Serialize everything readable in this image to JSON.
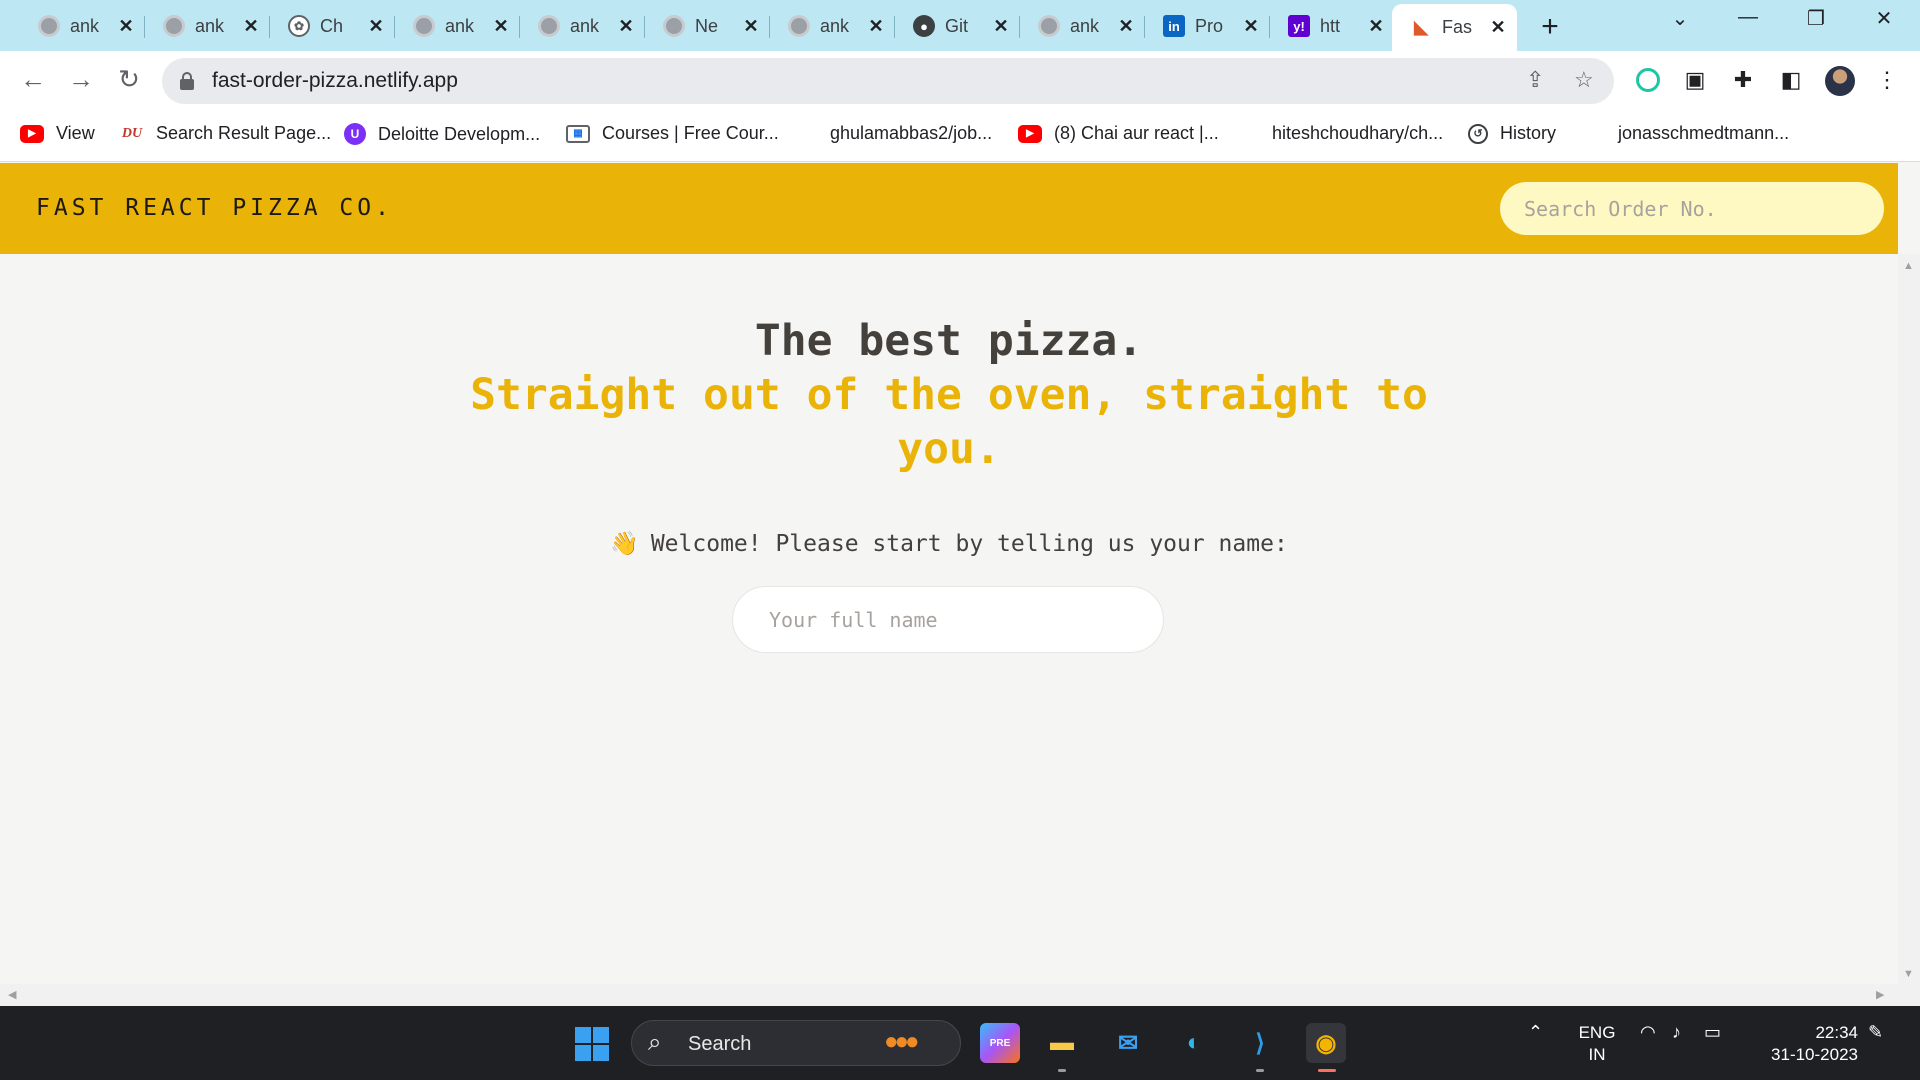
{
  "browser": {
    "tabs": [
      {
        "title": "ank",
        "icon": "globe-icon"
      },
      {
        "title": "ank",
        "icon": "globe-icon"
      },
      {
        "title": "Ch",
        "icon": "chatgpt-icon"
      },
      {
        "title": "ank",
        "icon": "globe-icon"
      },
      {
        "title": "ank",
        "icon": "globe-icon"
      },
      {
        "title": "Ne",
        "icon": "globe-icon"
      },
      {
        "title": "ank",
        "icon": "globe-icon"
      },
      {
        "title": "Git",
        "icon": "github-icon"
      },
      {
        "title": "ank",
        "icon": "globe-icon"
      },
      {
        "title": "Pro",
        "icon": "linkedin-icon"
      },
      {
        "title": "htt",
        "icon": "yahoo-icon"
      },
      {
        "title": "Fas",
        "icon": "pizza-icon",
        "active": true
      }
    ],
    "url": "fast-order-pizza.netlify.app",
    "bookmarks": [
      {
        "label": "View",
        "icon": "youtube-icon"
      },
      {
        "label": "Search Result Page...",
        "icon": "du-icon"
      },
      {
        "label": "Deloitte Developm...",
        "icon": "deloitte-icon"
      },
      {
        "label": "Courses | Free Cour...",
        "icon": "courses-icon"
      },
      {
        "label": "ghulamabbas2/job...",
        "icon": ""
      },
      {
        "label": "(8) Chai aur react |...",
        "icon": "youtube-icon"
      },
      {
        "label": "hiteshchoudhary/ch...",
        "icon": ""
      },
      {
        "label": "History",
        "icon": "history-icon"
      },
      {
        "label": "jonasschmedtmann...",
        "icon": ""
      }
    ]
  },
  "app": {
    "brand": "FAST REACT PIZZA CO.",
    "search_placeholder": "Search Order No.",
    "heading_line1": "The best pizza.",
    "heading_line2": "Straight out of the oven, straight to you.",
    "welcome_text": "Welcome! Please start by telling us your name:",
    "welcome_emoji": "👋",
    "name_placeholder": "Your full name",
    "colors": {
      "accent": "#eab308",
      "background": "#f5f5f4",
      "search_bg": "#fef9c3",
      "text": "#44403c"
    }
  },
  "taskbar": {
    "search_label": "Search",
    "lang_line1": "ENG",
    "lang_line2": "IN",
    "time": "22:34",
    "date": "31-10-2023"
  }
}
